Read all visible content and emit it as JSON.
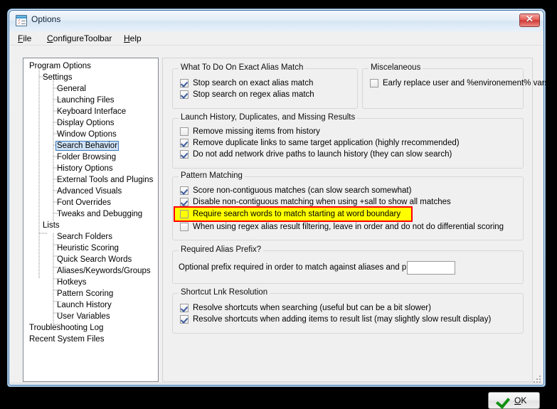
{
  "window": {
    "title": "Options",
    "icon": "options-list-icon",
    "close_label": "✕"
  },
  "menu": {
    "items": [
      {
        "label": "File",
        "accel": "F"
      },
      {
        "label": "ConfigureToolbar",
        "accel": "C"
      },
      {
        "label": "Help",
        "accel": "H"
      }
    ]
  },
  "tree": {
    "selected": "Search Behavior",
    "nodes": [
      {
        "label": "Program Options",
        "level": 0
      },
      {
        "label": "Settings",
        "level": 1
      },
      {
        "label": "General",
        "level": 2
      },
      {
        "label": "Launching Files",
        "level": 2
      },
      {
        "label": "Keyboard Interface",
        "level": 2
      },
      {
        "label": "Display Options",
        "level": 2
      },
      {
        "label": "Window Options",
        "level": 2
      },
      {
        "label": "Search Behavior",
        "level": 2,
        "selected": true
      },
      {
        "label": "Folder Browsing",
        "level": 2
      },
      {
        "label": "History Options",
        "level": 2
      },
      {
        "label": "External Tools and Plugins",
        "level": 2
      },
      {
        "label": "Advanced Visuals",
        "level": 2
      },
      {
        "label": "Font Overrides",
        "level": 2
      },
      {
        "label": "Tweaks and Debugging",
        "level": 2
      },
      {
        "label": "Lists",
        "level": 1
      },
      {
        "label": "Search Folders",
        "level": 2
      },
      {
        "label": "Heuristic Scoring",
        "level": 2
      },
      {
        "label": "Quick Search Words",
        "level": 2
      },
      {
        "label": "Aliases/Keywords/Groups",
        "level": 2
      },
      {
        "label": "Hotkeys",
        "level": 2
      },
      {
        "label": "Pattern Scoring",
        "level": 2
      },
      {
        "label": "Launch History",
        "level": 2
      },
      {
        "label": "User Variables",
        "level": 2
      },
      {
        "label": "Troubleshooting Log",
        "level": 0
      },
      {
        "label": "Recent System Files",
        "level": 0
      }
    ]
  },
  "groups": {
    "exact_alias": {
      "title": "What To Do On Exact Alias Match",
      "options": [
        {
          "label": "Stop search on exact alias match",
          "checked": true
        },
        {
          "label": "Stop search on regex alias match",
          "checked": true
        }
      ]
    },
    "miscelaneous": {
      "title": "Miscelaneous",
      "options": [
        {
          "label": "Early replace user and %environement% vars",
          "checked": false
        }
      ]
    },
    "launch_history": {
      "title": "Launch History, Duplicates, and Missing Results",
      "options": [
        {
          "label": "Remove missing items from history",
          "checked": false
        },
        {
          "label": "Remove duplicate links to same target application (highly rrecommended)",
          "checked": true
        },
        {
          "label": "Do not add network drive paths to launch history (they can slow search)",
          "checked": true
        }
      ]
    },
    "pattern_matching": {
      "title": "Pattern Matching",
      "options": [
        {
          "label": "Score non-contiguous matches (can slow search somewhat)",
          "checked": true
        },
        {
          "label": "Disable non-contiguous matching when using +sall to show all matches",
          "checked": true
        },
        {
          "label": "Require search words to match starting at word boundary",
          "checked": false,
          "highlighted": true
        },
        {
          "label": "When using regex alias result filtering, leave in order and do not do differential scoring",
          "checked": false
        }
      ]
    },
    "required_alias_prefix": {
      "title": "Required Alias Prefix?",
      "field_label": "Optional prefix required in order to match against aliases and plugins:",
      "field_value": "",
      "field_placeholder": ""
    },
    "shortcut_lnk": {
      "title": "Shortcut Lnk Resolution",
      "options": [
        {
          "label": "Resolve shortcuts when searching (useful but can be a bit slower)",
          "checked": true
        },
        {
          "label": "Resolve shortcuts when adding items to result list (may slightly slow result display)",
          "checked": true
        }
      ]
    }
  },
  "buttons": {
    "ok": {
      "label": "OK",
      "accel": "O",
      "icon": "green-check-icon"
    }
  },
  "colors": {
    "highlight_fill": "#ffff00",
    "highlight_border": "#ff0000",
    "selection_fill": "#cfe3f7",
    "selection_border": "#3a76b8",
    "window_bg": "#f0f0f0",
    "close_button": "#d03a36",
    "ok_check": "#109010"
  }
}
